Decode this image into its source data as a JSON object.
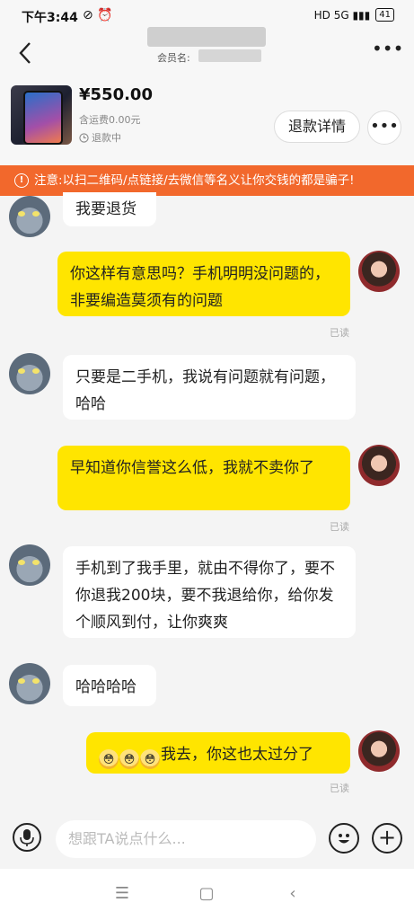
{
  "status_bar": {
    "time": "下午3:44",
    "icons_left": "⊘ ⏰",
    "signal": "HD 5G ▮▮▮",
    "battery": "41"
  },
  "header": {
    "member_label": "会员名:"
  },
  "product": {
    "price": "¥550.00",
    "shipping": "含运费0.00元",
    "status": "退款中",
    "refund_button": "退款详情"
  },
  "notice": "注意:以扫二维码/点链接/去微信等名义让你交钱的都是骗子!",
  "messages": [
    {
      "side": "left",
      "text": "我要退货"
    },
    {
      "side": "right",
      "text": "你这样有意思吗？手机明明没问题的，非要编造莫须有的问题",
      "read": "已读"
    },
    {
      "side": "left",
      "text": "只要是二手机，我说有问题就有问题，哈哈"
    },
    {
      "side": "right",
      "text": "早知道你信誉这么低，我就不卖你了",
      "read": "已读"
    },
    {
      "side": "left",
      "text": "手机到了我手里，就由不得你了，要不你退我200块，要不我退给你，给你发个顺风到付，让你爽爽"
    },
    {
      "side": "left",
      "text": "哈哈哈哈"
    },
    {
      "side": "right",
      "text": "我去，你这也太过分了",
      "read": "已读",
      "emoji_glyph": "😳"
    }
  ],
  "input": {
    "placeholder": "想跟TA说点什么..."
  },
  "icons": [
    "back-icon",
    "more-icon",
    "clock-icon",
    "warning-icon",
    "mic-icon",
    "emoji-icon",
    "plus-icon",
    "menu-icon",
    "home-icon",
    "back-nav-icon"
  ]
}
